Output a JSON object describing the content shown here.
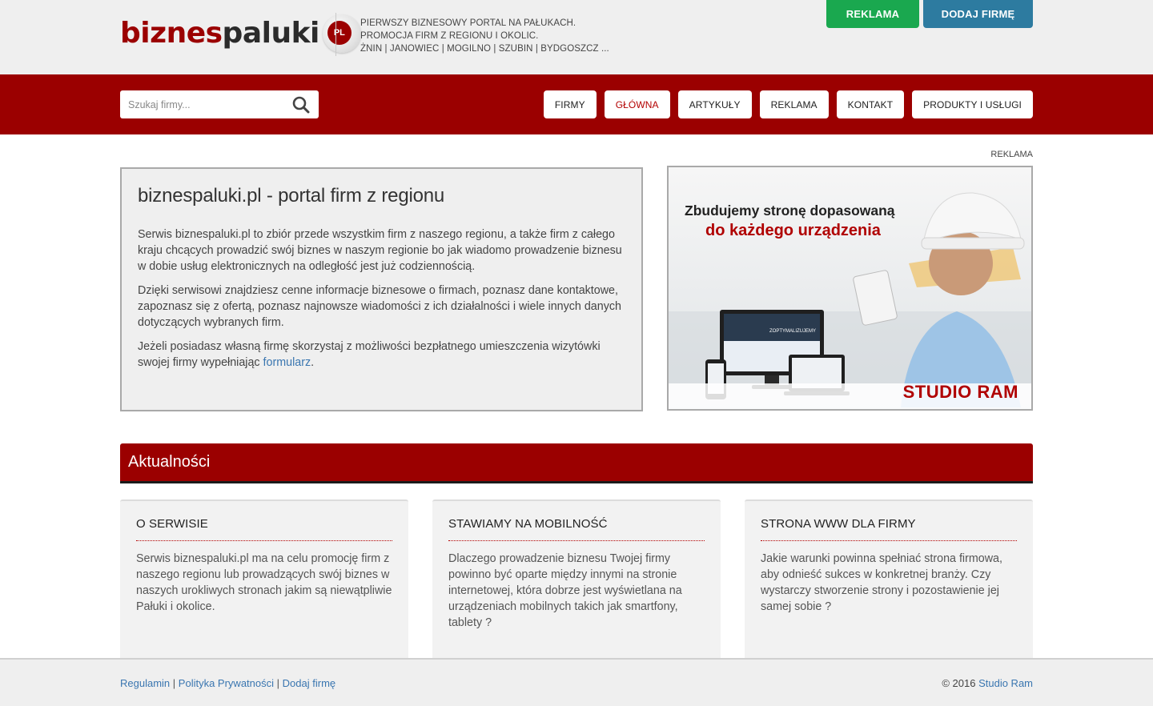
{
  "header": {
    "logo": {
      "part1": "biznes",
      "part2": "paluki",
      "badge": "PL"
    },
    "tagline": [
      "PIERWSZY BIZNESOWY PORTAL NA PAŁUKACH.",
      "PROMOCJA FIRM Z REGIONU I OKOLIC.",
      "ŻNIN | JANOWIEC | MOGILNO | SZUBIN | BYDGOSZCZ ..."
    ],
    "btn_reklama": "REKLAMA",
    "btn_dodaj": "DODAJ FIRMĘ"
  },
  "nav": {
    "search_placeholder": "Szukaj firmy...",
    "items": [
      "FIRMY",
      "GŁÓWNA",
      "ARTYKUŁY",
      "REKLAMA",
      "KONTAKT",
      "PRODUKTY I USŁUGI"
    ],
    "active_index": 1
  },
  "main": {
    "ad_label": "REKLAMA",
    "intro": {
      "title": "biznespaluki.pl - portal firm z regionu",
      "p1": "Serwis biznespaluki.pl to zbiór przede wszystkim firm z naszego regionu, a także firm z całego kraju chcących prowadzić swój biznes w naszym regionie bo jak wiadomo prowadzenie biznesu w dobie usług elektronicznych na odległość jest już codziennością.",
      "p2": "Dzięki serwisowi znajdziesz cenne informacje biznesowe o firmach, poznasz dane kontaktowe, zapoznasz się z ofertą, poznasz najnowsze wiadomości z ich działalności i wiele innych danych dotyczących wybranych firm.",
      "p3_text": "Jeżeli posiadasz własną firmę skorzystaj z możliwości bezpłatnego umieszczenia wizytówki swojej firmy wypełniając ",
      "p3_link": "formularz",
      "p3_end": "."
    },
    "banner": {
      "line1": "Zbudujemy stronę dopasowaną",
      "line2": "do każdego urządzenia",
      "brand": "STUDIO RAM",
      "screen_text": "ZOPTYMALIZUJEMY"
    }
  },
  "news": {
    "title": "Aktualności",
    "cards": [
      {
        "title": "O SERWISIE",
        "text": "Serwis biznespaluki.pl ma na celu promocję firm z naszego regionu lub prowadzących swój biznes w naszych urokliwych stronach jakim są niewątpliwie Pałuki i okolice."
      },
      {
        "title": "STAWIAMY NA MOBILNOŚĆ",
        "text": "Dlaczego prowadzenie biznesu Twojej firmy powinno być oparte między innymi na stronie internetowej, która dobrze jest wyświetlana na urządzeniach mobilnych takich jak smartfony, tablety ?"
      },
      {
        "title": "STRONA WWW DLA FIRMY",
        "text": "Jakie warunki powinna spełniać strona firmowa, aby odnieść sukces w konkretnej branży. Czy wystarczy stworzenie strony i pozostawienie jej samej sobie ?"
      }
    ]
  },
  "footer": {
    "links": [
      "Regulamin",
      "Polityka Prywatności",
      "Dodaj firmę"
    ],
    "separator": "|",
    "copyright": "© 2016",
    "copyright_link": "Studio Ram"
  },
  "colors": {
    "brand_red": "#9b0000",
    "green": "#1aa84f",
    "blue": "#2d7ba0",
    "link": "#3a76b0"
  }
}
